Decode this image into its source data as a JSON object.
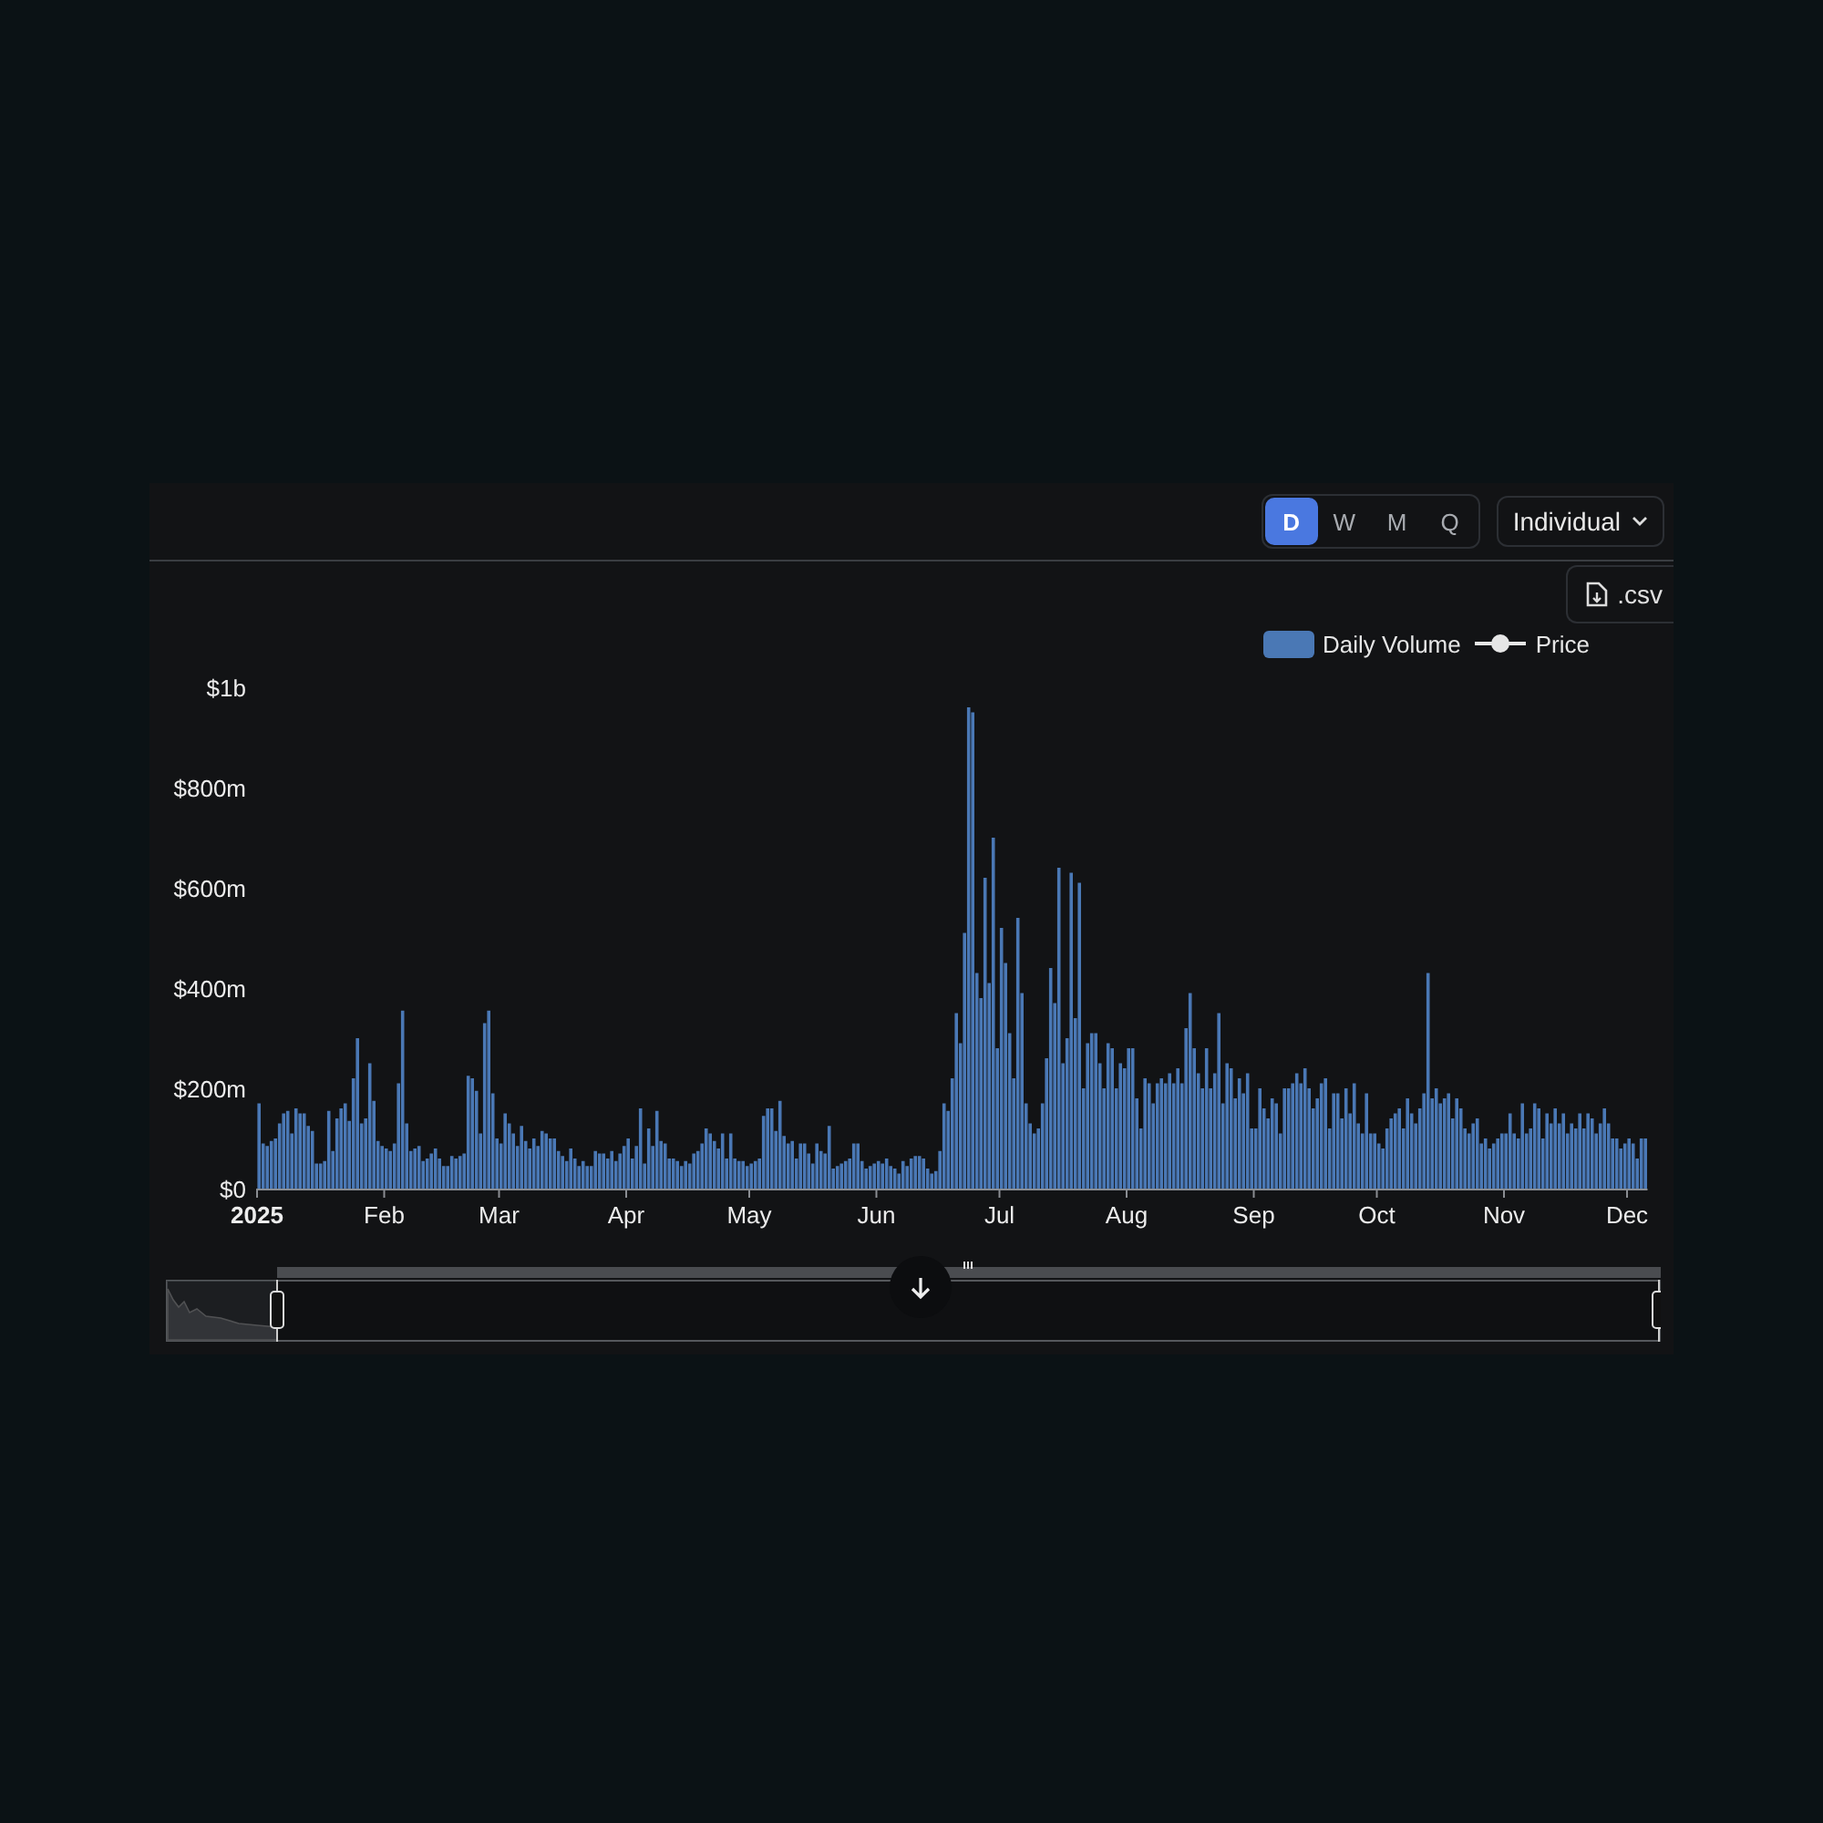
{
  "toolbar": {
    "periods": [
      {
        "label": "D",
        "selected": true
      },
      {
        "label": "W",
        "selected": false
      },
      {
        "label": "M",
        "selected": false
      },
      {
        "label": "Q",
        "selected": false
      }
    ],
    "mode_dropdown": {
      "value": "Individual"
    },
    "csv_button": {
      "label": ".csv"
    }
  },
  "legend": {
    "price_label": "Price"
  },
  "chart_data": {
    "type": "bar",
    "ylim": [
      0,
      1000000000
    ],
    "yticks": [
      {
        "value": 0,
        "label": "$0"
      },
      {
        "value": 200000000,
        "label": "$200m"
      },
      {
        "value": 400000000,
        "label": "$400m"
      },
      {
        "value": 600000000,
        "label": "$600m"
      },
      {
        "value": 800000000,
        "label": "$800m"
      },
      {
        "value": 1000000000,
        "label": "$1b"
      }
    ],
    "categories": [
      "2025",
      null,
      null,
      null,
      null,
      null,
      null,
      null,
      null,
      null,
      null,
      null,
      null,
      null,
      null,
      null,
      null,
      null,
      null,
      null,
      null,
      null,
      null,
      null,
      null,
      null,
      null,
      null,
      null,
      null,
      null,
      "Feb",
      null,
      null,
      null,
      null,
      null,
      null,
      null,
      null,
      null,
      null,
      null,
      null,
      null,
      null,
      null,
      null,
      null,
      null,
      null,
      null,
      null,
      null,
      null,
      null,
      null,
      null,
      null,
      "Mar",
      null,
      null,
      null,
      null,
      null,
      null,
      null,
      null,
      null,
      null,
      null,
      null,
      null,
      null,
      null,
      null,
      null,
      null,
      null,
      null,
      null,
      null,
      null,
      null,
      null,
      null,
      null,
      null,
      null,
      null,
      "Apr",
      null,
      null,
      null,
      null,
      null,
      null,
      null,
      null,
      null,
      null,
      null,
      null,
      null,
      null,
      null,
      null,
      null,
      null,
      null,
      null,
      null,
      null,
      null,
      null,
      null,
      null,
      null,
      null,
      null,
      "May",
      null,
      null,
      null,
      null,
      null,
      null,
      null,
      null,
      null,
      null,
      null,
      null,
      null,
      null,
      null,
      null,
      null,
      null,
      null,
      null,
      null,
      null,
      null,
      null,
      null,
      null,
      null,
      null,
      null,
      null,
      "Jun",
      null,
      null,
      null,
      null,
      null,
      null,
      null,
      null,
      null,
      null,
      null,
      null,
      null,
      null,
      null,
      null,
      null,
      null,
      null,
      null,
      null,
      null,
      null,
      null,
      null,
      null,
      null,
      null,
      null,
      "Jul",
      null,
      null,
      null,
      null,
      null,
      null,
      null,
      null,
      null,
      null,
      null,
      null,
      null,
      null,
      null,
      null,
      null,
      null,
      null,
      null,
      null,
      null,
      null,
      null,
      null,
      null,
      null,
      null,
      null,
      null,
      "Aug",
      null,
      null,
      null,
      null,
      null,
      null,
      null,
      null,
      null,
      null,
      null,
      null,
      null,
      null,
      null,
      null,
      null,
      null,
      null,
      null,
      null,
      null,
      null,
      null,
      null,
      null,
      null,
      null,
      null,
      null,
      "Sep",
      null,
      null,
      null,
      null,
      null,
      null,
      null,
      null,
      null,
      null,
      null,
      null,
      null,
      null,
      null,
      null,
      null,
      null,
      null,
      null,
      null,
      null,
      null,
      null,
      null,
      null,
      null,
      null,
      null,
      "Oct",
      null,
      null,
      null,
      null,
      null,
      null,
      null,
      null,
      null,
      null,
      null,
      null,
      null,
      null,
      null,
      null,
      null,
      null,
      null,
      null,
      null,
      null,
      null,
      null,
      null,
      null,
      null,
      null,
      null,
      null,
      "Nov",
      null,
      null,
      null,
      null,
      null,
      null,
      null,
      null,
      null,
      null,
      null,
      null,
      null,
      null,
      null,
      null,
      null,
      null,
      null,
      null,
      null,
      null,
      null,
      null,
      null,
      null,
      null,
      null,
      null,
      "Dec",
      null,
      null,
      null,
      null
    ],
    "series": [
      {
        "name": "Daily Volume",
        "color": "#4a78b5",
        "values": [
          170000000.0,
          90000000.0,
          85000000.0,
          95000000.0,
          100000000.0,
          130000000.0,
          150000000.0,
          155000000.0,
          110000000.0,
          160000000.0,
          150000000.0,
          150000000.0,
          125000000.0,
          115000000.0,
          50000000.0,
          50000000.0,
          55000000.0,
          155000000.0,
          75000000.0,
          140000000.0,
          160000000.0,
          170000000.0,
          135000000.0,
          220000000.0,
          300000000.0,
          130000000.0,
          140000000.0,
          250000000.0,
          175000000.0,
          95000000.0,
          85000000.0,
          80000000.0,
          75000000.0,
          90000000.0,
          210000000.0,
          355000000.0,
          130000000.0,
          75000000.0,
          80000000.0,
          85000000.0,
          55000000.0,
          60000000.0,
          70000000.0,
          80000000.0,
          60000000.0,
          45000000.0,
          45000000.0,
          65000000.0,
          60000000.0,
          65000000.0,
          70000000.0,
          225000000.0,
          220000000.0,
          195000000.0,
          110000000.0,
          330000000.0,
          355000000.0,
          190000000.0,
          100000000.0,
          90000000.0,
          150000000.0,
          130000000.0,
          110000000.0,
          85000000.0,
          125000000.0,
          95000000.0,
          80000000.0,
          100000000.0,
          85000000.0,
          115000000.0,
          110000000.0,
          100000000.0,
          100000000.0,
          75000000.0,
          65000000.0,
          55000000.0,
          80000000.0,
          60000000.0,
          45000000.0,
          55000000.0,
          45000000.0,
          45000000.0,
          75000000.0,
          70000000.0,
          70000000.0,
          60000000.0,
          75000000.0,
          55000000.0,
          70000000.0,
          85000000.0,
          100000000.0,
          60000000.0,
          85000000.0,
          160000000.0,
          50000000.0,
          120000000.0,
          85000000.0,
          155000000.0,
          95000000.0,
          90000000.0,
          60000000.0,
          60000000.0,
          55000000.0,
          45000000.0,
          55000000.0,
          50000000.0,
          70000000.0,
          75000000.0,
          90000000.0,
          120000000.0,
          110000000.0,
          95000000.0,
          80000000.0,
          110000000.0,
          60000000.0,
          110000000.0,
          60000000.0,
          55000000.0,
          55000000.0,
          45000000.0,
          50000000.0,
          55000000.0,
          60000000.0,
          145000000.0,
          160000000.0,
          160000000.0,
          115000000.0,
          175000000.0,
          105000000.0,
          90000000.0,
          95000000.0,
          60000000.0,
          90000000.0,
          90000000.0,
          70000000.0,
          50000000.0,
          90000000.0,
          75000000.0,
          70000000.0,
          125000000.0,
          40000000.0,
          45000000.0,
          50000000.0,
          55000000.0,
          60000000.0,
          90000000.0,
          90000000.0,
          55000000.0,
          40000000.0,
          45000000.0,
          50000000.0,
          55000000.0,
          50000000.0,
          60000000.0,
          45000000.0,
          40000000.0,
          30000000.0,
          55000000.0,
          45000000.0,
          60000000.0,
          65000000.0,
          65000000.0,
          60000000.0,
          40000000.0,
          30000000.0,
          35000000.0,
          75000000.0,
          170000000.0,
          155000000.0,
          220000000.0,
          350000000.0,
          290000000.0,
          510000000.0,
          960000000.0,
          950000000.0,
          430000000.0,
          380000000.0,
          620000000.0,
          410000000.0,
          700000000.0,
          280000000.0,
          520000000.0,
          450000000.0,
          310000000.0,
          220000000.0,
          540000000.0,
          390000000.0,
          170000000.0,
          130000000.0,
          110000000.0,
          120000000.0,
          170000000.0,
          260000000.0,
          440000000.0,
          370000000.0,
          640000000.0,
          250000000.0,
          300000000.0,
          630000000.0,
          340000000.0,
          610000000.0,
          200000000.0,
          290000000.0,
          310000000.0,
          310000000.0,
          250000000.0,
          200000000.0,
          290000000.0,
          280000000.0,
          200000000.0,
          250000000.0,
          240000000.0,
          280000000.0,
          280000000.0,
          180000000.0,
          120000000.0,
          220000000.0,
          210000000.0,
          170000000.0,
          210000000.0,
          220000000.0,
          210000000.0,
          230000000.0,
          210000000.0,
          240000000.0,
          210000000.0,
          320000000.0,
          390000000.0,
          280000000.0,
          230000000.0,
          200000000.0,
          280000000.0,
          200000000.0,
          230000000.0,
          350000000.0,
          170000000.0,
          250000000.0,
          240000000.0,
          180000000.0,
          220000000.0,
          190000000.0,
          230000000.0,
          120000000.0,
          120000000.0,
          200000000.0,
          160000000.0,
          140000000.0,
          180000000.0,
          170000000.0,
          110000000.0,
          200000000.0,
          200000000.0,
          210000000.0,
          230000000.0,
          210000000.0,
          240000000.0,
          200000000.0,
          160000000.0,
          180000000.0,
          210000000.0,
          220000000.0,
          120000000.0,
          190000000.0,
          190000000.0,
          140000000.0,
          200000000.0,
          150000000.0,
          210000000.0,
          130000000.0,
          110000000.0,
          190000000.0,
          110000000.0,
          110000000.0,
          90000000.0,
          80000000.0,
          120000000.0,
          140000000.0,
          150000000.0,
          160000000.0,
          120000000.0,
          180000000.0,
          150000000.0,
          130000000.0,
          160000000.0,
          190000000.0,
          430000000.0,
          180000000.0,
          200000000.0,
          170000000.0,
          180000000.0,
          190000000.0,
          140000000.0,
          180000000.0,
          160000000.0,
          120000000.0,
          110000000.0,
          130000000.0,
          140000000.0,
          90000000.0,
          100000000.0,
          80000000.0,
          90000000.0,
          100000000.0,
          110000000.0,
          110000000.0,
          150000000.0,
          110000000.0,
          100000000.0,
          170000000.0,
          110000000.0,
          120000000.0,
          170000000.0,
          160000000.0,
          100000000.0,
          150000000.0,
          130000000.0,
          160000000.0,
          130000000.0,
          150000000.0,
          110000000.0,
          130000000.0,
          120000000.0,
          150000000.0,
          120000000.0,
          150000000.0,
          140000000.0,
          110000000.0,
          130000000.0,
          160000000.0,
          130000000.0,
          100000000.0,
          100000000.0,
          80000000.0,
          90000000.0,
          100000000.0,
          90000000.0,
          60000000.0,
          100000000.0,
          100000000.0
        ]
      }
    ]
  }
}
